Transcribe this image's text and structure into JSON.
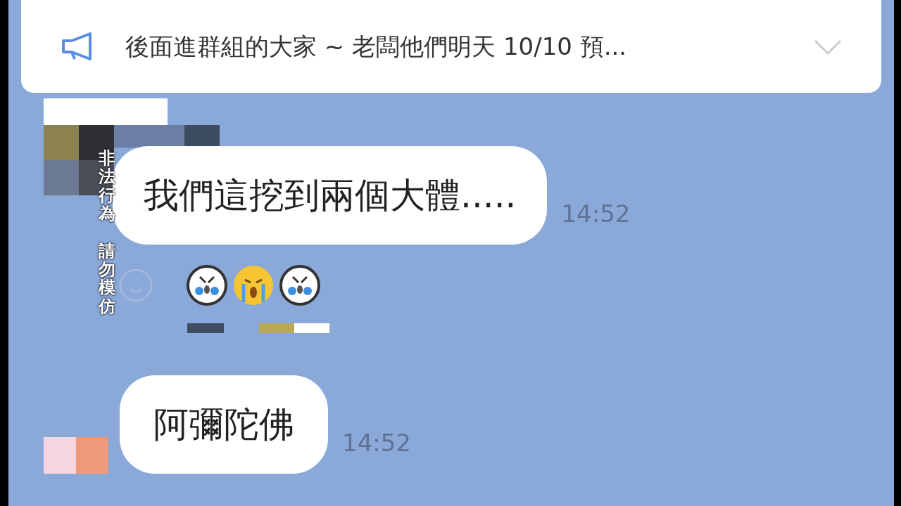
{
  "announcement": {
    "text": "後面進群組的大家 ~ 老闆他們明天 10/10 預...",
    "expanded": false
  },
  "messages": [
    {
      "text": "我們這挖到兩個大體.....",
      "time": "14:52",
      "reactions": [
        {
          "kind": "wince"
        },
        {
          "kind": "cry"
        },
        {
          "kind": "wince"
        }
      ]
    },
    {
      "text": "阿彌陀佛",
      "time": "14:52"
    }
  ],
  "caption": [
    "非法行為",
    "請勿模仿"
  ]
}
